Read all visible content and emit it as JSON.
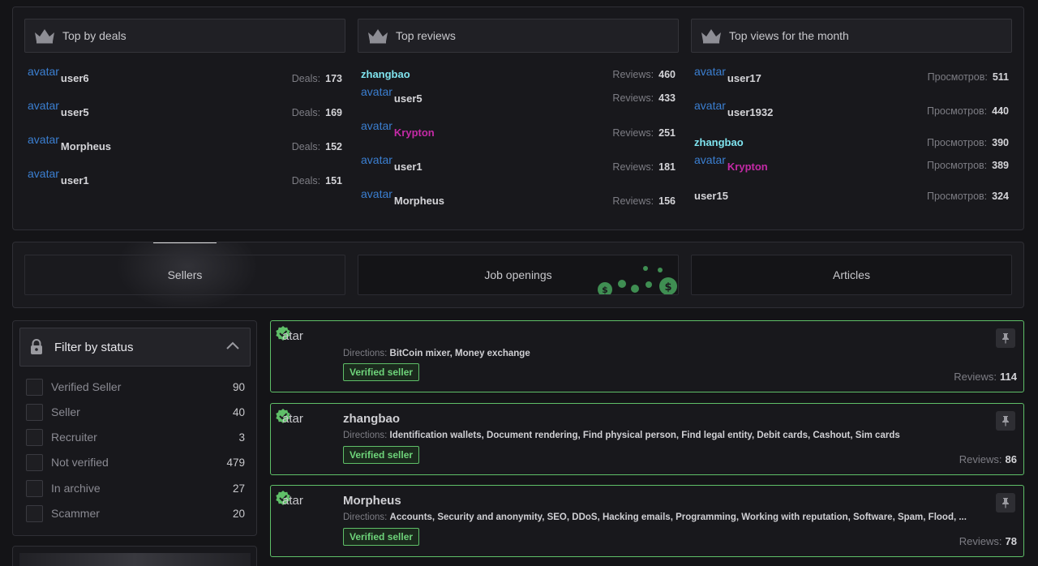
{
  "top": {
    "deals": {
      "title": "Top by deals",
      "rows": [
        {
          "avatar": "avatar",
          "user": "user6",
          "label": "Deals:",
          "value": "173"
        },
        {
          "avatar": "avatar",
          "user": "user5",
          "label": "Deals:",
          "value": "169"
        },
        {
          "avatar": "avatar",
          "user": "Morpheus",
          "label": "Deals:",
          "value": "152"
        },
        {
          "avatar": "avatar",
          "user": "user1",
          "label": "Deals:",
          "value": "151"
        }
      ]
    },
    "reviews": {
      "title": "Top reviews",
      "rows": [
        {
          "avatar": "",
          "user": "zhangbao",
          "label": "Reviews:",
          "value": "460"
        },
        {
          "avatar": "avatar",
          "user": "user5",
          "label": "Reviews:",
          "value": "433"
        },
        {
          "avatar": "avatar",
          "user": "Krypton",
          "label": "Reviews:",
          "value": "251"
        },
        {
          "avatar": "avatar",
          "user": "user1",
          "label": "Reviews:",
          "value": "181"
        },
        {
          "avatar": "avatar",
          "user": "Morpheus",
          "label": "Reviews:",
          "value": "156"
        }
      ]
    },
    "views": {
      "title": "Top views for the month",
      "rows": [
        {
          "avatar": "avatar",
          "user": "user17",
          "label": "Просмотров:",
          "value": "511"
        },
        {
          "avatar": "avatar",
          "user": "user1932",
          "label": "Просмотров:",
          "value": "440"
        },
        {
          "avatar": "",
          "user": "zhangbao",
          "label": "Просмотров:",
          "value": "390"
        },
        {
          "avatar": "avatar",
          "user": "Krypton",
          "label": "Просмотров:",
          "value": "389"
        },
        {
          "avatar": "",
          "user": "user15",
          "label": "Просмотров:",
          "value": "324"
        }
      ]
    }
  },
  "tabs": {
    "sellers": "Sellers",
    "jobs": "Job openings",
    "articles": "Articles"
  },
  "filter": {
    "title": "Filter by status",
    "items": [
      {
        "label": "Verified Seller",
        "count": "90"
      },
      {
        "label": "Seller",
        "count": "40"
      },
      {
        "label": "Recruiter",
        "count": "3"
      },
      {
        "label": "Not verified",
        "count": "479"
      },
      {
        "label": "In archive",
        "count": "27"
      },
      {
        "label": "Scammer",
        "count": "20"
      }
    ]
  },
  "cards": [
    {
      "atar": "atar",
      "name": "",
      "dir_label": "Directions:",
      "directions": "BitCoin mixer, Money exchange",
      "badge": "Verified seller",
      "reviews_label": "Reviews:",
      "reviews": "114"
    },
    {
      "atar": "atar",
      "name": "zhangbao",
      "dir_label": "Directions:",
      "directions": "Identification wallets, Document rendering, Find physical person, Find legal entity, Debit cards, Cashout, Sim cards",
      "badge": "Verified seller",
      "reviews_label": "Reviews:",
      "reviews": "86"
    },
    {
      "atar": "atar",
      "name": "Morpheus",
      "dir_label": "Directions:",
      "directions": "Accounts, Security and anonymity, SEO, DDoS, Hacking emails, Programming, Working with reputation, Software, Spam, Flood, ...",
      "badge": "Verified seller",
      "reviews_label": "Reviews:",
      "reviews": "78"
    }
  ],
  "colors": {
    "accent_green": "#5fbf68",
    "link_blue": "#3b7fd1",
    "user_cyan": "#7fe3ee",
    "user_magenta": "#c42aa6"
  },
  "icons": {
    "crown": "crown-icon",
    "lock": "lock-icon",
    "chevron": "chevron-up-icon",
    "pin": "pin-icon",
    "verified": "verified-check-icon"
  }
}
